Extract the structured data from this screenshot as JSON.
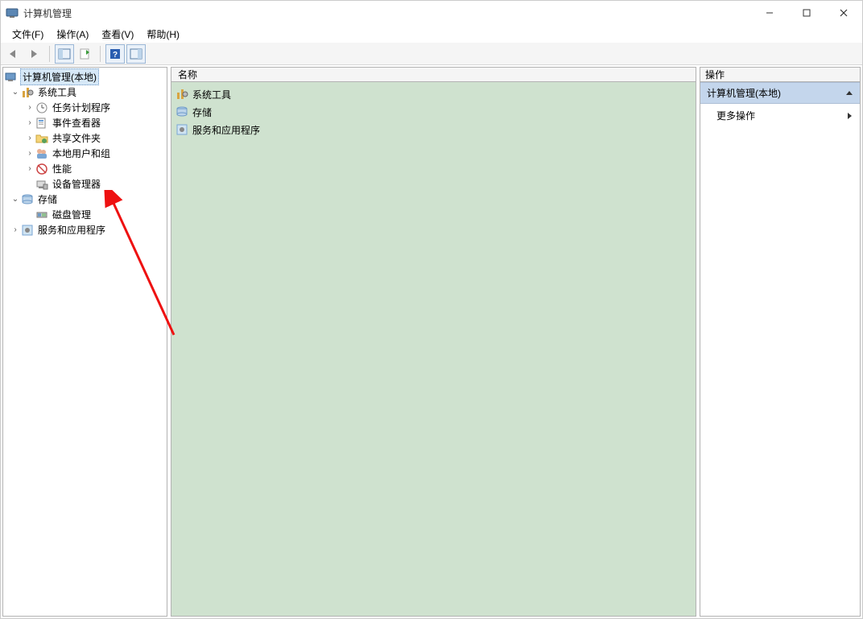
{
  "window": {
    "title": "计算机管理"
  },
  "menu": {
    "file": "文件(F)",
    "action": "操作(A)",
    "view": "查看(V)",
    "help": "帮助(H)"
  },
  "tree": {
    "root": "计算机管理(本地)",
    "system_tools": "系统工具",
    "task_scheduler": "任务计划程序",
    "event_viewer": "事件查看器",
    "shared_folders": "共享文件夹",
    "local_users": "本地用户和组",
    "performance": "性能",
    "device_manager": "设备管理器",
    "storage": "存储",
    "disk_management": "磁盘管理",
    "services_apps": "服务和应用程序"
  },
  "content": {
    "header_name": "名称",
    "items": {
      "system_tools": "系统工具",
      "storage": "存储",
      "services_apps": "服务和应用程序"
    }
  },
  "actions": {
    "header": "操作",
    "section_title": "计算机管理(本地)",
    "more_actions": "更多操作"
  }
}
